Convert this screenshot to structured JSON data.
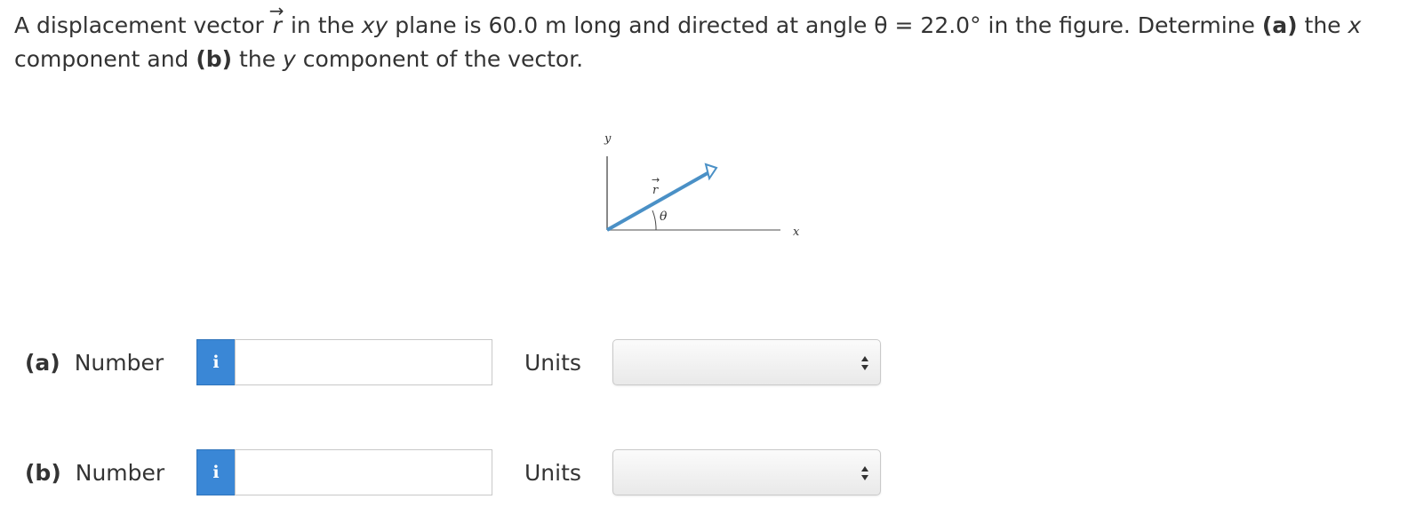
{
  "question": {
    "p1": "A displacement vector ",
    "vector_symbol": "r",
    "p2": " in the ",
    "xy": "xy",
    "p3": " plane is 60.0 m long and directed at angle θ = 22.0° in the figure. Determine ",
    "a_marker": "(a)",
    "p4": " the ",
    "x": "x",
    "p5": " component and ",
    "b_marker": "(b)",
    "p6": " the ",
    "y": "y",
    "p7": " component of the vector."
  },
  "figure": {
    "y_axis_label": "y",
    "x_axis_label": "x",
    "vector_label": "r",
    "angle_label": "θ",
    "vector_color": "#4a90c6"
  },
  "answers": [
    {
      "part": "(a)",
      "number_label": "Number",
      "info_icon": "info-icon",
      "info_glyph": "i",
      "number_value": "",
      "units_label": "Units",
      "units_selected": ""
    },
    {
      "part": "(b)",
      "number_label": "Number",
      "info_icon": "info-icon",
      "info_glyph": "i",
      "number_value": "",
      "units_label": "Units",
      "units_selected": ""
    }
  ],
  "colors": {
    "info_button": "#3a87d6",
    "text": "#333333"
  }
}
